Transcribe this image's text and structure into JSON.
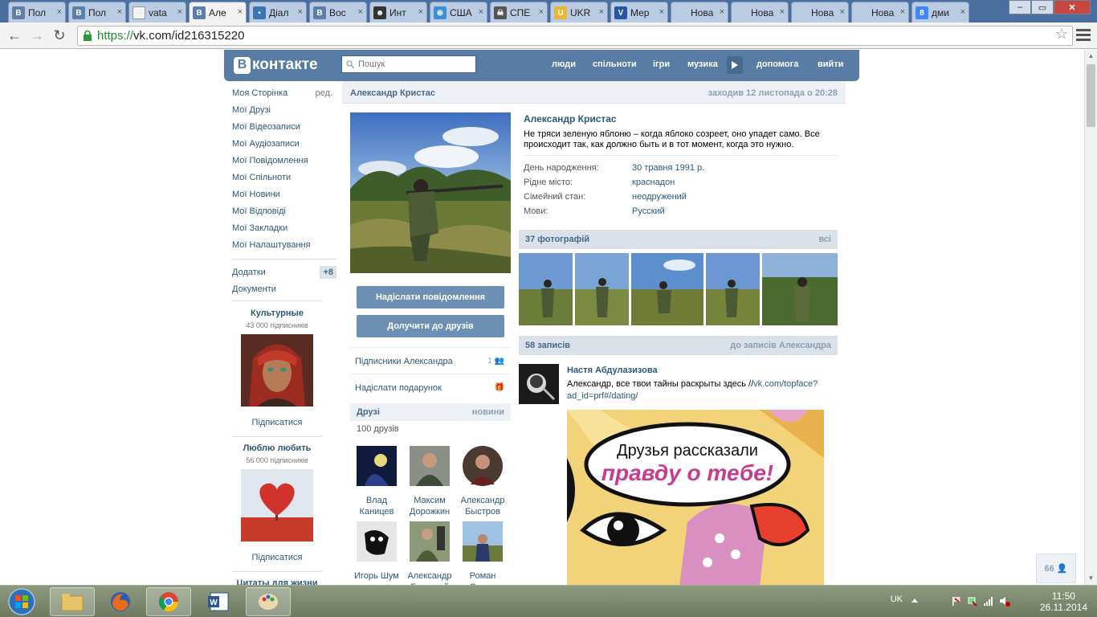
{
  "browser": {
    "tabs": [
      {
        "label": "Пол",
        "icon": "vk"
      },
      {
        "label": "Пол",
        "icon": "vk"
      },
      {
        "label": "vata",
        "icon": "page"
      },
      {
        "label": "Але",
        "icon": "vk",
        "active": true
      },
      {
        "label": "Діал",
        "icon": "chat"
      },
      {
        "label": "Вос",
        "icon": "vk"
      },
      {
        "label": "Инт",
        "icon": "face"
      },
      {
        "label": "США",
        "icon": "globe"
      },
      {
        "label": "СПЕ",
        "icon": "skull"
      },
      {
        "label": "UKR",
        "icon": "ukr"
      },
      {
        "label": "Мер",
        "icon": "voa"
      },
      {
        "label": "Нова в",
        "icon": "none"
      },
      {
        "label": "Нова в",
        "icon": "none"
      },
      {
        "label": "Нова в",
        "icon": "none"
      },
      {
        "label": "Нова в",
        "icon": "none"
      },
      {
        "label": "дми",
        "icon": "google"
      }
    ],
    "url_scheme": "https://",
    "url_rest": "vk.com/id216315220"
  },
  "vk": {
    "logo_text": "контакте",
    "logo_letter": "В",
    "search_placeholder": "Пошук",
    "nav": [
      "люди",
      "спільноти",
      "ігри",
      "музика",
      "допомога",
      "вийти"
    ],
    "left_menu": [
      "Моя Сторінка",
      "Мої Друзі",
      "Мої Відеозаписи",
      "Мої Аудіозаписи",
      "Мої Повідомлення",
      "Мої Спільноти",
      "Мої Новини",
      "Мої Відповіді",
      "Мої Закладки",
      "Мої Налаштування"
    ],
    "edit_label": "ред.",
    "apps_label": "Додатки",
    "apps_badge": "+8",
    "docs_label": "Документи",
    "groups": [
      {
        "title": "Культурные",
        "subs": "43 000 підписників",
        "btn": "Підписатися"
      },
      {
        "title": "Люблю любить",
        "subs": "56 000 підписників",
        "btn": "Підписатися"
      },
      {
        "title": "Цитаты для жизни"
      }
    ],
    "profile": {
      "name": "Александр Кристас",
      "last_seen": "заходив 12 листопада о 20:28",
      "status": "Не тряси зеленую яблоню – когда яблоко созреет, оно упадет само. Все происходит так, как должно быть и в тот момент, когда это нужно.",
      "info": [
        {
          "label": "День народження:",
          "value": "30 травня 1991 р."
        },
        {
          "label": "Рідне місто:",
          "value": "краснадон"
        },
        {
          "label": "Сімейний стан:",
          "value": "неодружений"
        },
        {
          "label": "Мови:",
          "value": "Русский"
        }
      ],
      "btn_message": "Надіслати повідомлення",
      "btn_add": "Долучити до друзів",
      "followers_link": "Підписники Александра",
      "followers_count": "1",
      "gift_link": "Надіслати подарунок",
      "friends_title": "Друзі",
      "friends_new": "новини",
      "friends_count": "100 друзів",
      "friends": [
        {
          "name": "Влад Каницев"
        },
        {
          "name": "Максим Дорожкин"
        },
        {
          "name": "Александр Быстров"
        },
        {
          "name": "Игорь Шум"
        },
        {
          "name": "Александр Бельский"
        },
        {
          "name": "Роман Орлов"
        }
      ],
      "photos_title": "37 фотографій",
      "photos_all": "всі",
      "posts_title": "58 записів",
      "posts_link": "до записів Александра",
      "post_author": "Настя Абдулазизова",
      "post_text": "Александр, все твои тайны раскрыты здесь //",
      "post_link": "vk.com/topface?ad_id=prf#/dating/",
      "ad_line1": "Друзья рассказали",
      "ad_line2": "правду о тебе!"
    },
    "online_count": "66"
  },
  "taskbar": {
    "lang": "UK",
    "time": "11:50",
    "date": "26.11.2014"
  },
  "colors": {
    "vk_blue": "#587ca3",
    "link": "#2b587a",
    "header_bg": "#dae1e8",
    "chrome_frame": "#4a6f9e"
  }
}
